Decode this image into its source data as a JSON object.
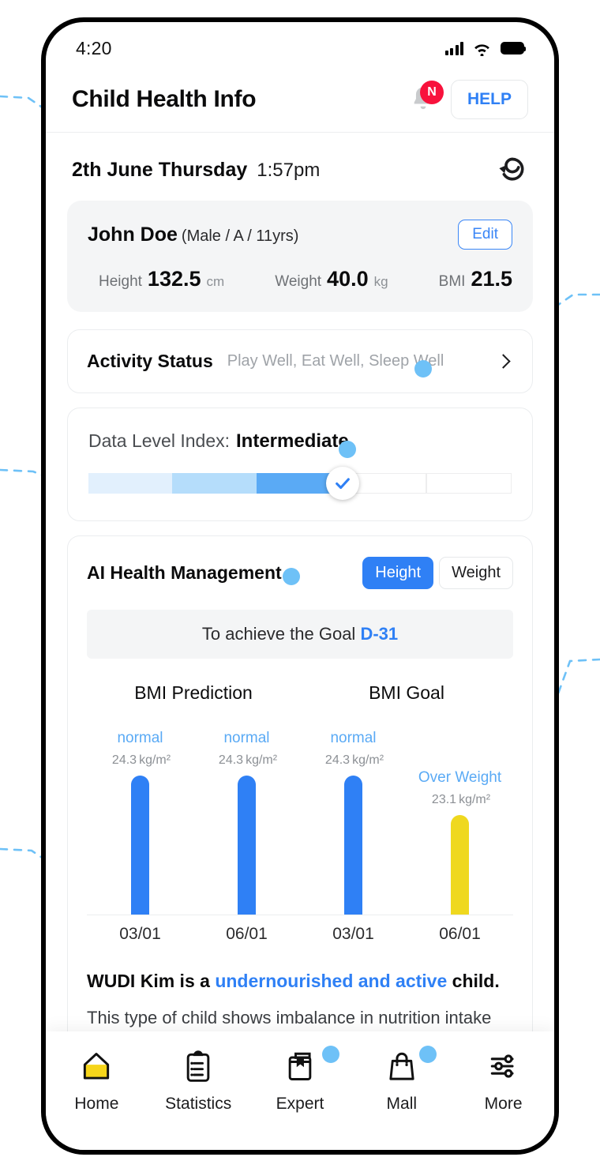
{
  "status_bar": {
    "time": "4:20",
    "icons": [
      "signal-icon",
      "wifi-icon",
      "battery-icon"
    ]
  },
  "header": {
    "title": "Child Health Info",
    "bell_icon": "bell-icon",
    "notification_badge": "N",
    "help_label": "HELP"
  },
  "date_row": {
    "date": "2th June Thursday",
    "time": "1:57pm",
    "refresh_icon": "refresh-icon"
  },
  "profile": {
    "name": "John Doe",
    "meta": "(Male / A / 11yrs)",
    "edit_label": "Edit",
    "metrics": [
      {
        "label": "Height",
        "value": "132.5",
        "unit": "cm"
      },
      {
        "label": "Weight",
        "value": "40.0",
        "unit": "kg"
      },
      {
        "label": "BMI",
        "value": "21.5",
        "unit": ""
      }
    ]
  },
  "activity": {
    "title": "Activity Status",
    "subtitle": "Play Well, Eat Well, Sleep Well",
    "chevron_icon": "chevron-right-icon"
  },
  "data_level": {
    "label": "Data Level Index:",
    "value": "Intermediate",
    "segments_total": 5,
    "segments_filled": 3,
    "knob_icon": "check-icon",
    "colors": [
      "#e2f0fd",
      "#b5ddfb",
      "#5aaaf5"
    ]
  },
  "ai_section": {
    "title": "AI Health Management",
    "toggle": {
      "options": [
        "Height",
        "Weight"
      ],
      "selected": "Height"
    },
    "goal_banner_prefix": "To achieve the Goal",
    "goal_banner_value": "D-31"
  },
  "chart_data": [
    {
      "type": "bar",
      "title": "BMI Prediction",
      "categories": [
        "03/01",
        "06/01"
      ],
      "values": [
        24.3,
        24.3
      ],
      "unit": "kg/m²",
      "point_labels": [
        "normal",
        "normal"
      ],
      "colors": [
        "#2f80f5",
        "#2f80f5"
      ],
      "xlabel": "",
      "ylabel": "",
      "grid": false
    },
    {
      "type": "bar",
      "title": "BMI Goal",
      "categories": [
        "03/01",
        "06/01"
      ],
      "values": [
        24.3,
        23.1
      ],
      "unit": "kg/m²",
      "point_labels": [
        "normal",
        "Over Weight"
      ],
      "colors": [
        "#2f80f5",
        "#efd81f"
      ],
      "xlabel": "",
      "ylabel": "",
      "grid": false
    }
  ],
  "summary": {
    "head_prefix": "WUDI Kim is a ",
    "head_highlight": "undernourished and active",
    "head_suffix": " child.",
    "body": "This type of child shows imbalance in nutrition intake"
  },
  "tab_bar": {
    "items": [
      {
        "label": "Home",
        "icon": "home-icon",
        "active": true
      },
      {
        "label": "Statistics",
        "icon": "clipboard-icon",
        "active": false
      },
      {
        "label": "Expert",
        "icon": "book-icon",
        "active": false
      },
      {
        "label": "Mall",
        "icon": "shopping-bag-icon",
        "active": false
      },
      {
        "label": "More",
        "icon": "sliders-icon",
        "active": false
      }
    ]
  }
}
